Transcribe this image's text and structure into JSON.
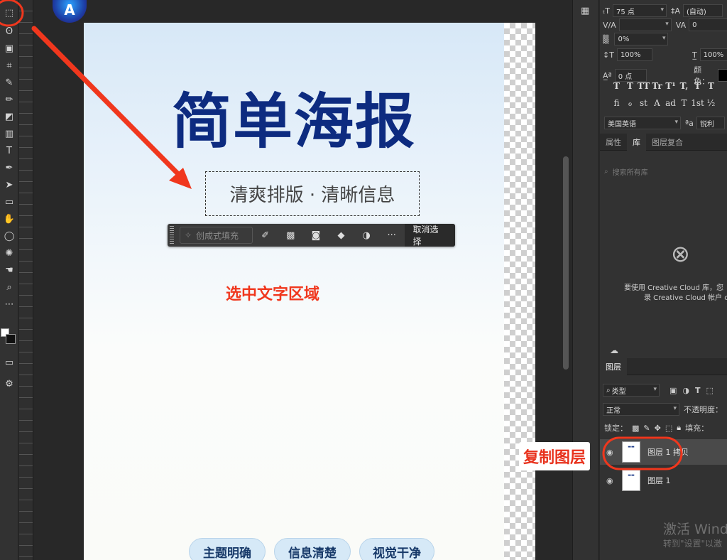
{
  "colors": {
    "accent_red": "#f0371d",
    "poster_title": "#0d2b80",
    "panel_bg": "#323232"
  },
  "toolbar": {
    "tools": [
      {
        "name": "rect-marquee-icon",
        "glyph": "⬚"
      },
      {
        "name": "lasso-icon",
        "glyph": "ʘ"
      },
      {
        "name": "object-select-icon",
        "glyph": "▣"
      },
      {
        "name": "crop-icon",
        "glyph": "⌗"
      },
      {
        "name": "eyedropper-icon",
        "glyph": "✎"
      },
      {
        "name": "brush-icon",
        "glyph": "✏"
      },
      {
        "name": "eraser-icon",
        "glyph": "◩"
      },
      {
        "name": "gradient-icon",
        "glyph": "▥"
      },
      {
        "name": "type-icon",
        "glyph": "T"
      },
      {
        "name": "pen-icon",
        "glyph": "✒"
      },
      {
        "name": "path-select-icon",
        "glyph": "➤"
      },
      {
        "name": "rectangle-icon",
        "glyph": "▭"
      },
      {
        "name": "dodge-icon",
        "glyph": "✋"
      },
      {
        "name": "ellipse-icon",
        "glyph": "◯"
      },
      {
        "name": "custom-shape-icon",
        "glyph": "✺"
      },
      {
        "name": "hand-icon",
        "glyph": "☚"
      },
      {
        "name": "zoom-icon",
        "glyph": "⌕"
      },
      {
        "name": "more-tools-icon",
        "glyph": "⋯"
      }
    ]
  },
  "poster": {
    "title": "简单海报",
    "subtitle": "清爽排版 · 清晰信息",
    "tags": [
      "主题明确",
      "信息清楚",
      "视觉干净"
    ]
  },
  "context_bar": {
    "generative_fill": "创成式填充",
    "deselect": "取消选择"
  },
  "annotations": {
    "select_text": "选中文字区域",
    "duplicate_layer": "复制图层"
  },
  "character_panel": {
    "font_size": "75 点",
    "leading": "(自动)",
    "tracking": "0",
    "kerning": "",
    "scale_label": "0%",
    "vscale": "100%",
    "hscale": "100%",
    "baseline": "0 点",
    "color_label": "颜色：",
    "language": "美国英语",
    "aa_label": "ªa",
    "antialias": "锐利",
    "text_buttons": [
      "T",
      "T",
      "TT",
      "Tr",
      "T¹",
      "T,",
      "T",
      "T"
    ],
    "ot_buttons": [
      "fi",
      "ℴ",
      "st",
      "A",
      "ad",
      "T",
      "1st",
      "½"
    ]
  },
  "library_panel": {
    "tabs": [
      "属性",
      "库",
      "图层复合"
    ],
    "search_placeholder": "搜索所有库",
    "message_line1": "要使用 Creative Cloud 库，您",
    "message_line2": "录 Creative Cloud 帐户 c"
  },
  "layers_panel": {
    "tab": "图层",
    "filter_kind": "类型",
    "blend_mode": "正常",
    "opacity_label": "不透明度：",
    "lock_label": "锁定：",
    "fill_label": "填充：",
    "layers": [
      {
        "name": "图层 1 拷贝",
        "selected": true
      },
      {
        "name": "图层 1",
        "selected": false
      }
    ]
  },
  "watermark": {
    "line1": "激活 Wind",
    "line2": "转到\"设置\"以激"
  }
}
